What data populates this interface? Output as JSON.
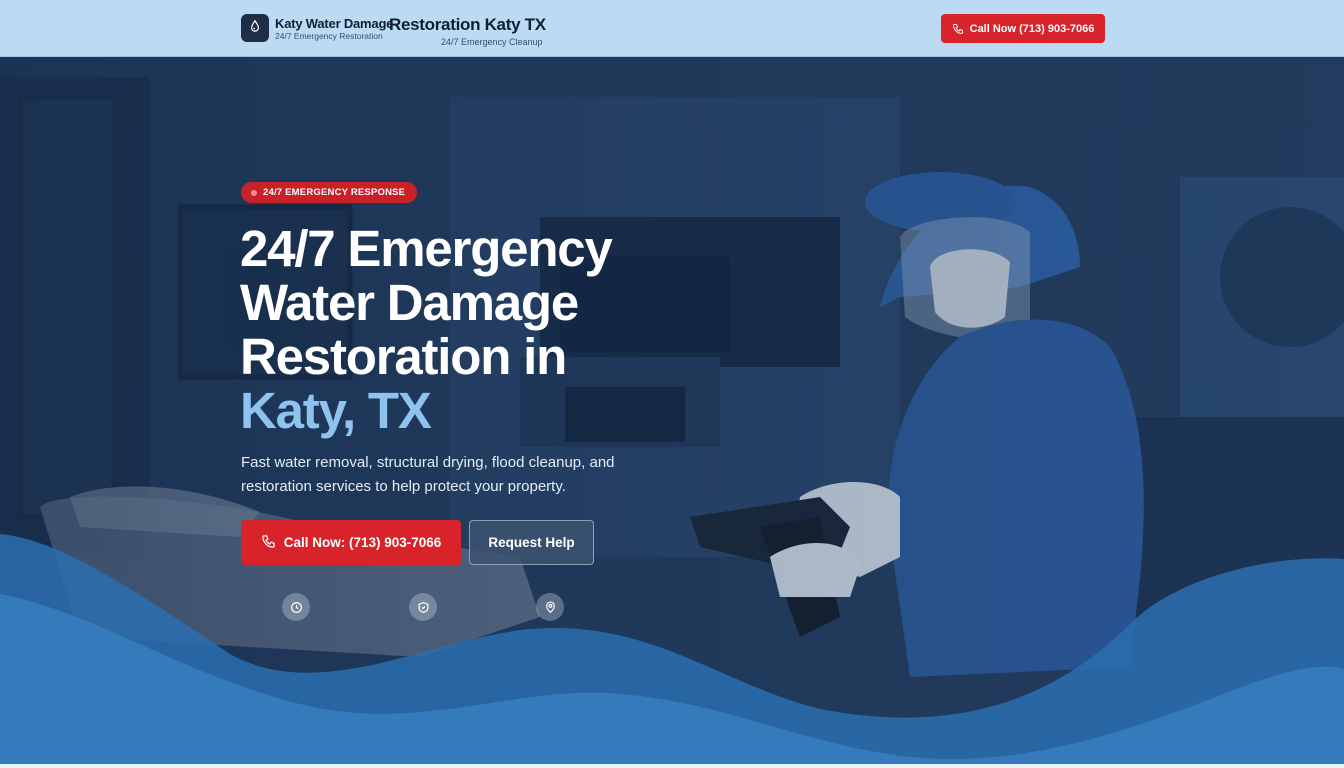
{
  "header": {
    "brand_name": "Katy Water Damage",
    "brand_sub": "24/7 Emergency Restoration",
    "brand_title": "Restoration Katy TX",
    "brand_title_sub": "24/7 Emergency Cleanup",
    "cta_label": "Call Now  (713) 903-7066",
    "logo_icon": "water-drop-icon",
    "cta_icon": "phone-icon"
  },
  "hero": {
    "badge": "24/7 EMERGENCY RESPONSE",
    "headline_lines": [
      "24/7 Emergency",
      "Water Damage",
      "Restoration in"
    ],
    "headline_accent": "Katy, TX",
    "lead_line1": "Fast water removal, structural drying, flood cleanup, and",
    "lead_line2": "restoration services to help protect your property.",
    "call_button": "Call Now: (713) 903-7066",
    "help_button": "Request Help",
    "feature_icons": [
      "clock-icon",
      "shield-check-icon",
      "location-pin-icon"
    ]
  },
  "colors": {
    "header_bg": "#bcdaf2",
    "accent_red": "#d9232b",
    "accent_blue": "#8ec2ef",
    "hero_bg": "#1d3a5f",
    "wave": "#2a6fb0"
  }
}
